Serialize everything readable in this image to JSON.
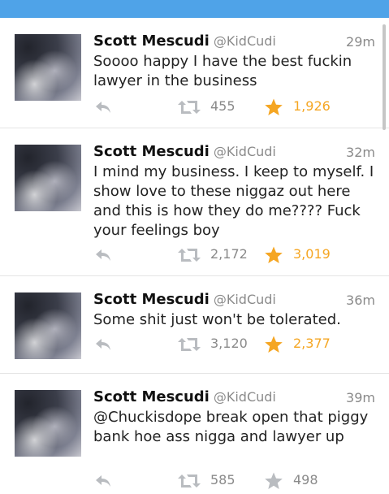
{
  "tweets": [
    {
      "name": "Scott Mescudi",
      "handle": "@KidCudi",
      "time": "29m",
      "text": "Soooo happy I have the best fuckin lawyer in the business",
      "retweets": "455",
      "favorites": "1,926",
      "favorited": true
    },
    {
      "name": "Scott Mescudi",
      "handle": "@KidCudi",
      "time": "32m",
      "text": "I mind my business. I keep to myself. I show love to these niggaz out here and this is how they do me???? Fuck your feelings boy",
      "retweets": "2,172",
      "favorites": "3,019",
      "favorited": true
    },
    {
      "name": "Scott Mescudi",
      "handle": "@KidCudi",
      "time": "36m",
      "text": "Some shit just won't be tolerated.",
      "retweets": "3,120",
      "favorites": "2,377",
      "favorited": true
    },
    {
      "name": "Scott Mescudi",
      "handle": "@KidCudi",
      "time": "39m",
      "text": "@Chuckisdope break open that piggy bank hoe ass nigga and lawyer up",
      "retweets": "585",
      "favorites": "498",
      "favorited": false
    }
  ],
  "colors": {
    "topbar": "#4fa3e8",
    "favorite_active": "#f5a623",
    "icon_gray": "#b9bcc0"
  },
  "icons": [
    "reply-icon",
    "retweet-icon",
    "star-icon"
  ]
}
